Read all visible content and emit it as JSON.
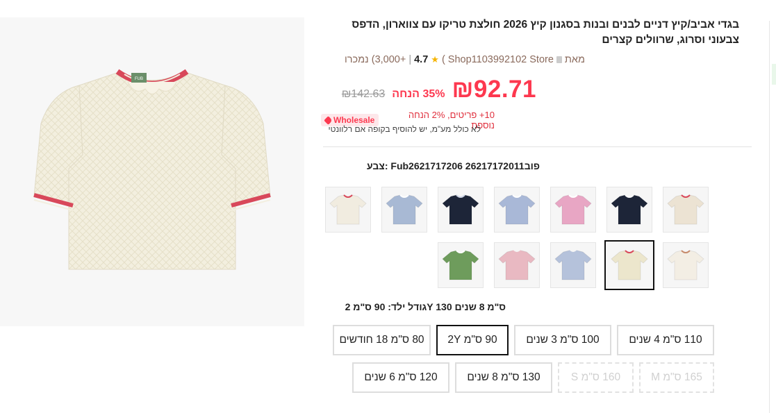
{
  "product": {
    "title": "בגדי אביב/קיץ דניים לבנים ובנות בסגנון קיץ 2026 חולצת טריקו עם צווארון, הדפס צבעוני וסרוג, שרוולים קצרים"
  },
  "store": {
    "from_label": "מאת",
    "name": "Shop1103992102 Store",
    "rating": "4.7",
    "sold": "+3,000) נמכרו"
  },
  "price": {
    "current": "₪92.71",
    "discount": "35% הנחה",
    "original": "₪142.63"
  },
  "promo": {
    "badge_label": "Wholesale",
    "text": "10+ פריטים, 2% הנחה נוספת",
    "vat_note": "לא כולל מע\"מ, יש להוסיף בקופה אם רלוונטי"
  },
  "color_section": {
    "heading": "צבע: Fub2621717206 26217172011פוב"
  },
  "size_section": {
    "heading": "גודל ילד: 90 ס\"מ 2Y 130 ס\"מ 8 שנים"
  },
  "sizes": [
    {
      "label": "110 ס\"מ 4 שנים",
      "state": "normal"
    },
    {
      "label": "100 ס\"מ 3 שנים",
      "state": "normal"
    },
    {
      "label": "90 ס\"מ 2Y",
      "state": "selected"
    },
    {
      "label": "80 ס\"מ 18 חודשים",
      "state": "normal"
    },
    {
      "label": "165 ס\"מ M",
      "state": "disabled"
    },
    {
      "label": "160 ס\"מ S",
      "state": "disabled"
    },
    {
      "label": "130 ס\"מ 8 שנים",
      "state": "normal"
    },
    {
      "label": "120 ס\"מ 6 שנים",
      "state": "normal"
    }
  ],
  "swatches": [
    {
      "icon": "cream-polo-red-trim",
      "color": "#ece3d3",
      "trim": "#d8485a"
    },
    {
      "icon": "navy-polo",
      "color": "#1d2538",
      "trim": "#ffffff"
    },
    {
      "icon": "pink-polo",
      "color": "#e8a6c4",
      "trim": "#ffffff"
    },
    {
      "icon": "lightblue-polo",
      "color": "#a9b8d7",
      "trim": "#ffffff"
    },
    {
      "icon": "navy-stripe-polo",
      "color": "#1d2538",
      "trim": "#cfd6e6"
    },
    {
      "icon": "blue-stripe-polo",
      "color": "#a8b9d4",
      "trim": "#ffffff"
    },
    {
      "icon": "cream-polo-stripe",
      "color": "#f1ece0",
      "trim": "#d8485a"
    },
    {
      "icon": "floral-polo",
      "color": "#f3eee4",
      "trim": "#c68a6b"
    },
    {
      "icon": "cream-tee-red-trim",
      "color": "#ece6cc",
      "trim": "#d8485a"
    },
    {
      "icon": "lightblue-tee",
      "color": "#b5c2db",
      "trim": "#b5c2db"
    },
    {
      "icon": "pink-tee",
      "color": "#e9b9c2",
      "trim": "#e9b9c2"
    },
    {
      "icon": "green-polo",
      "color": "#6e9c5c",
      "trim": "#ffffff"
    }
  ],
  "colors": {
    "price_red": "#fd384f",
    "accent_badge_bg": "#fde7ea",
    "selected_border": "#111111"
  }
}
